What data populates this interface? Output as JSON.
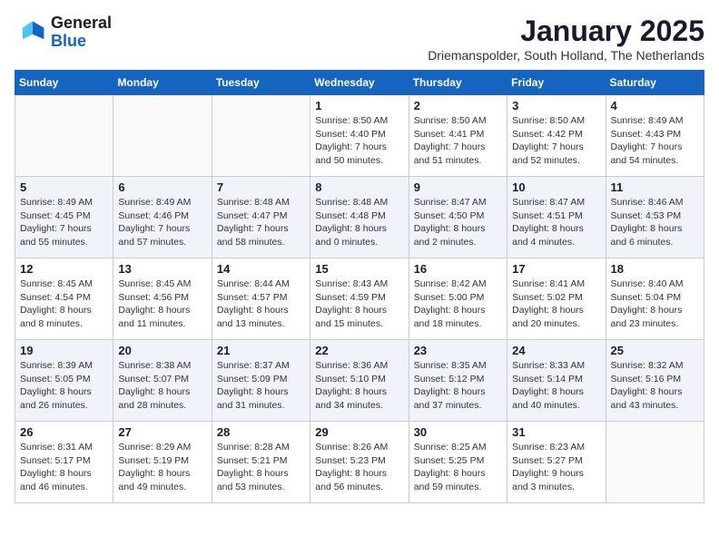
{
  "logo": {
    "general": "General",
    "blue": "Blue"
  },
  "header": {
    "title": "January 2025",
    "subtitle": "Driemanspolder, South Holland, The Netherlands"
  },
  "weekdays": [
    "Sunday",
    "Monday",
    "Tuesday",
    "Wednesday",
    "Thursday",
    "Friday",
    "Saturday"
  ],
  "weeks": [
    [
      {
        "day": "",
        "info": ""
      },
      {
        "day": "",
        "info": ""
      },
      {
        "day": "",
        "info": ""
      },
      {
        "day": "1",
        "info": "Sunrise: 8:50 AM\nSunset: 4:40 PM\nDaylight: 7 hours\nand 50 minutes."
      },
      {
        "day": "2",
        "info": "Sunrise: 8:50 AM\nSunset: 4:41 PM\nDaylight: 7 hours\nand 51 minutes."
      },
      {
        "day": "3",
        "info": "Sunrise: 8:50 AM\nSunset: 4:42 PM\nDaylight: 7 hours\nand 52 minutes."
      },
      {
        "day": "4",
        "info": "Sunrise: 8:49 AM\nSunset: 4:43 PM\nDaylight: 7 hours\nand 54 minutes."
      }
    ],
    [
      {
        "day": "5",
        "info": "Sunrise: 8:49 AM\nSunset: 4:45 PM\nDaylight: 7 hours\nand 55 minutes."
      },
      {
        "day": "6",
        "info": "Sunrise: 8:49 AM\nSunset: 4:46 PM\nDaylight: 7 hours\nand 57 minutes."
      },
      {
        "day": "7",
        "info": "Sunrise: 8:48 AM\nSunset: 4:47 PM\nDaylight: 7 hours\nand 58 minutes."
      },
      {
        "day": "8",
        "info": "Sunrise: 8:48 AM\nSunset: 4:48 PM\nDaylight: 8 hours\nand 0 minutes."
      },
      {
        "day": "9",
        "info": "Sunrise: 8:47 AM\nSunset: 4:50 PM\nDaylight: 8 hours\nand 2 minutes."
      },
      {
        "day": "10",
        "info": "Sunrise: 8:47 AM\nSunset: 4:51 PM\nDaylight: 8 hours\nand 4 minutes."
      },
      {
        "day": "11",
        "info": "Sunrise: 8:46 AM\nSunset: 4:53 PM\nDaylight: 8 hours\nand 6 minutes."
      }
    ],
    [
      {
        "day": "12",
        "info": "Sunrise: 8:45 AM\nSunset: 4:54 PM\nDaylight: 8 hours\nand 8 minutes."
      },
      {
        "day": "13",
        "info": "Sunrise: 8:45 AM\nSunset: 4:56 PM\nDaylight: 8 hours\nand 11 minutes."
      },
      {
        "day": "14",
        "info": "Sunrise: 8:44 AM\nSunset: 4:57 PM\nDaylight: 8 hours\nand 13 minutes."
      },
      {
        "day": "15",
        "info": "Sunrise: 8:43 AM\nSunset: 4:59 PM\nDaylight: 8 hours\nand 15 minutes."
      },
      {
        "day": "16",
        "info": "Sunrise: 8:42 AM\nSunset: 5:00 PM\nDaylight: 8 hours\nand 18 minutes."
      },
      {
        "day": "17",
        "info": "Sunrise: 8:41 AM\nSunset: 5:02 PM\nDaylight: 8 hours\nand 20 minutes."
      },
      {
        "day": "18",
        "info": "Sunrise: 8:40 AM\nSunset: 5:04 PM\nDaylight: 8 hours\nand 23 minutes."
      }
    ],
    [
      {
        "day": "19",
        "info": "Sunrise: 8:39 AM\nSunset: 5:05 PM\nDaylight: 8 hours\nand 26 minutes."
      },
      {
        "day": "20",
        "info": "Sunrise: 8:38 AM\nSunset: 5:07 PM\nDaylight: 8 hours\nand 28 minutes."
      },
      {
        "day": "21",
        "info": "Sunrise: 8:37 AM\nSunset: 5:09 PM\nDaylight: 8 hours\nand 31 minutes."
      },
      {
        "day": "22",
        "info": "Sunrise: 8:36 AM\nSunset: 5:10 PM\nDaylight: 8 hours\nand 34 minutes."
      },
      {
        "day": "23",
        "info": "Sunrise: 8:35 AM\nSunset: 5:12 PM\nDaylight: 8 hours\nand 37 minutes."
      },
      {
        "day": "24",
        "info": "Sunrise: 8:33 AM\nSunset: 5:14 PM\nDaylight: 8 hours\nand 40 minutes."
      },
      {
        "day": "25",
        "info": "Sunrise: 8:32 AM\nSunset: 5:16 PM\nDaylight: 8 hours\nand 43 minutes."
      }
    ],
    [
      {
        "day": "26",
        "info": "Sunrise: 8:31 AM\nSunset: 5:17 PM\nDaylight: 8 hours\nand 46 minutes."
      },
      {
        "day": "27",
        "info": "Sunrise: 8:29 AM\nSunset: 5:19 PM\nDaylight: 8 hours\nand 49 minutes."
      },
      {
        "day": "28",
        "info": "Sunrise: 8:28 AM\nSunset: 5:21 PM\nDaylight: 8 hours\nand 53 minutes."
      },
      {
        "day": "29",
        "info": "Sunrise: 8:26 AM\nSunset: 5:23 PM\nDaylight: 8 hours\nand 56 minutes."
      },
      {
        "day": "30",
        "info": "Sunrise: 8:25 AM\nSunset: 5:25 PM\nDaylight: 8 hours\nand 59 minutes."
      },
      {
        "day": "31",
        "info": "Sunrise: 8:23 AM\nSunset: 5:27 PM\nDaylight: 9 hours\nand 3 minutes."
      },
      {
        "day": "",
        "info": ""
      }
    ]
  ]
}
